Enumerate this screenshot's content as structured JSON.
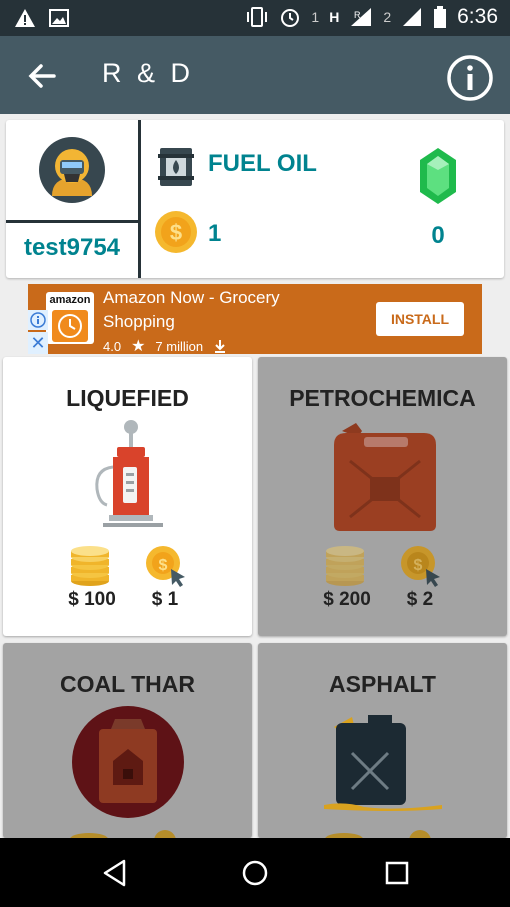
{
  "status_bar": {
    "sim1": "1",
    "sim1_net": "H",
    "sim1_roam": "R",
    "sim2": "2",
    "time": "6:36"
  },
  "app_bar": {
    "title": "R & D",
    "back_icon": "arrow-left-icon",
    "info_icon": "info-icon"
  },
  "profile": {
    "username": "test9754",
    "fuel_name": "FUEL OIL",
    "coins": "1",
    "gems": "0"
  },
  "ad": {
    "logo_text": "amazon",
    "title": "Amazon Now - Grocery Shopping",
    "rating": "4.0",
    "star": "★",
    "downloads": "7 million",
    "install_label": "INSTALL",
    "close_glyph": "✕"
  },
  "products": [
    {
      "name": "LIQUEFIED",
      "price": "$ 100",
      "tap_price": "$ 1",
      "unlocked": true
    },
    {
      "name": "PETROCHEMICA",
      "price": "$ 200",
      "tap_price": "$ 2",
      "unlocked": false
    },
    {
      "name": "COAL THAR",
      "unlocked": false
    },
    {
      "name": "ASPHALT",
      "unlocked": false
    }
  ],
  "colors": {
    "app_bar": "#455a64",
    "status_bar": "#263238",
    "accent_teal": "#00838f",
    "locked_card": "#a3a3a3",
    "ad_orange": "#c96a1a"
  }
}
